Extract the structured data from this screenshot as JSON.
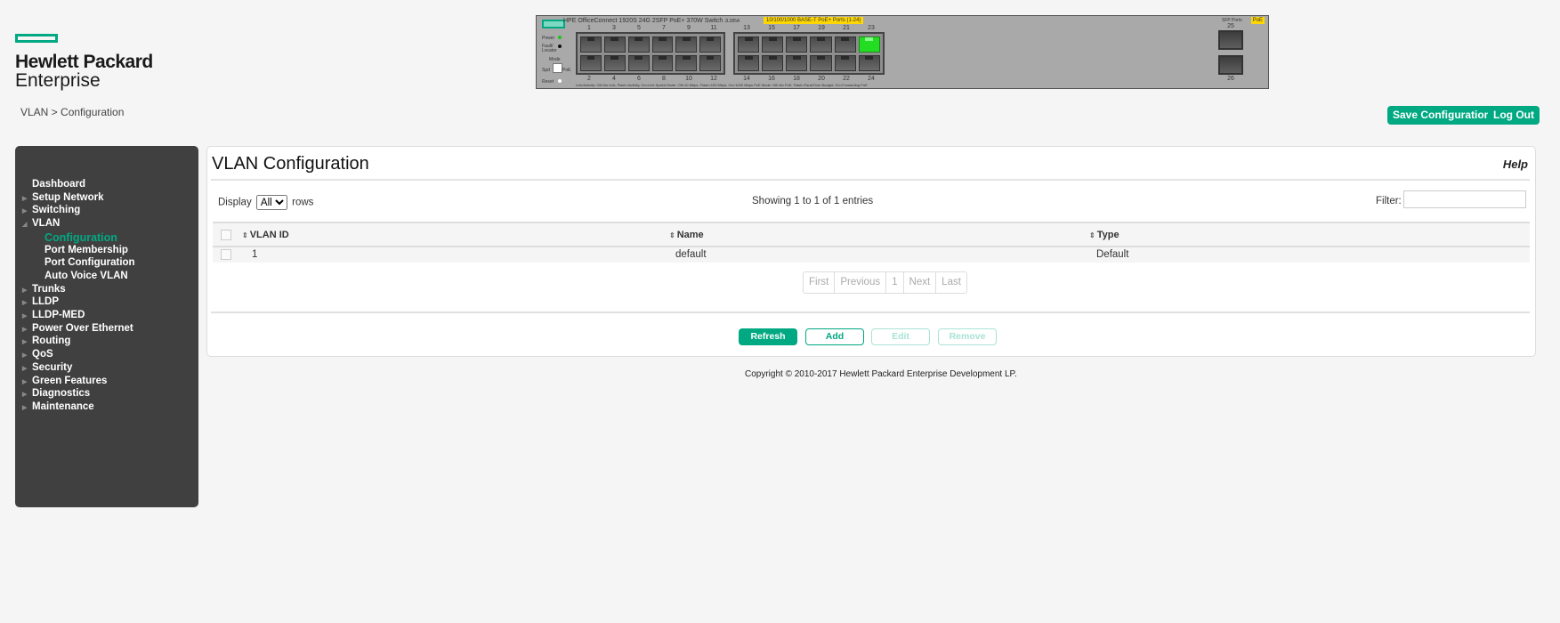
{
  "logo": {
    "line1": "Hewlett Packard",
    "line2": "Enterprise"
  },
  "breadcrumb": "VLAN > Configuration",
  "device": {
    "model": "HPE OfficeConnect 1920S 24G 2SFP PoE+ 370W Switch",
    "model_code": "JL385A",
    "ports_banner": "10/100/1000 BASE-T PoE+ Ports (1-24)",
    "sfp_label": "SFP Ports",
    "poe_badge": "PoE",
    "leds": {
      "power": "Power",
      "fault": "Fault/ Locator",
      "mode": "Mode",
      "spd": "Spd",
      "poe": "PoE",
      "reset": "Reset"
    },
    "legend": "Link/Activity: Off=No Link, Flash=Activity, On=Link    Speed Mode: Off=10 Mbps, Flash=100 Mbps, On=1000 Mbps    PoE Mode: Off=No PoE, Flash=Fault/Over Budget, On=Forwarding PoE",
    "top_ports": [
      "1",
      "3",
      "5",
      "7",
      "9",
      "11",
      "13",
      "15",
      "17",
      "19",
      "21",
      "23"
    ],
    "bottom_ports": [
      "2",
      "4",
      "6",
      "8",
      "10",
      "12",
      "14",
      "16",
      "18",
      "20",
      "22",
      "24"
    ],
    "sfp_ports": [
      "25",
      "26"
    ],
    "active_ports": [
      "23"
    ]
  },
  "header_buttons": {
    "save": "Save Configuration",
    "logout": "Log Out"
  },
  "sidebar": {
    "items": [
      {
        "label": "Dashboard",
        "expandable": false
      },
      {
        "label": "Setup Network",
        "expandable": true
      },
      {
        "label": "Switching",
        "expandable": true
      },
      {
        "label": "VLAN",
        "expandable": true,
        "expanded": true
      },
      {
        "label": "Configuration",
        "sub": true,
        "selected": true
      },
      {
        "label": "Port Membership",
        "sub": true
      },
      {
        "label": "Port Configuration",
        "sub": true
      },
      {
        "label": "Auto Voice VLAN",
        "sub": true
      },
      {
        "label": "Trunks",
        "expandable": true
      },
      {
        "label": "LLDP",
        "expandable": true
      },
      {
        "label": "LLDP-MED",
        "expandable": true
      },
      {
        "label": "Power Over Ethernet",
        "expandable": true
      },
      {
        "label": "Routing",
        "expandable": true
      },
      {
        "label": "QoS",
        "expandable": true
      },
      {
        "label": "Security",
        "expandable": true
      },
      {
        "label": "Green Features",
        "expandable": true
      },
      {
        "label": "Diagnostics",
        "expandable": true
      },
      {
        "label": "Maintenance",
        "expandable": true
      }
    ]
  },
  "panel": {
    "title": "VLAN Configuration",
    "help": "Help",
    "display_label": "Display",
    "display_value": "All",
    "rows_label": "rows",
    "showing": "Showing 1 to 1 of 1 entries",
    "filter_label": "Filter:",
    "filter_value": "",
    "columns": [
      "VLAN ID",
      "Name",
      "Type"
    ],
    "rows": [
      {
        "vlan_id": "1",
        "name": "default",
        "type": "Default"
      }
    ],
    "pager": [
      "First",
      "Previous",
      "1",
      "Next",
      "Last"
    ],
    "buttons": {
      "refresh": "Refresh",
      "add": "Add",
      "edit": "Edit",
      "remove": "Remove"
    }
  },
  "copyright": "Copyright © 2010-2017 Hewlett Packard Enterprise Development LP.",
  "colors": {
    "accent": "#01a982",
    "sidebar_bg": "#404040",
    "page_bg": "#f5f5f5"
  }
}
